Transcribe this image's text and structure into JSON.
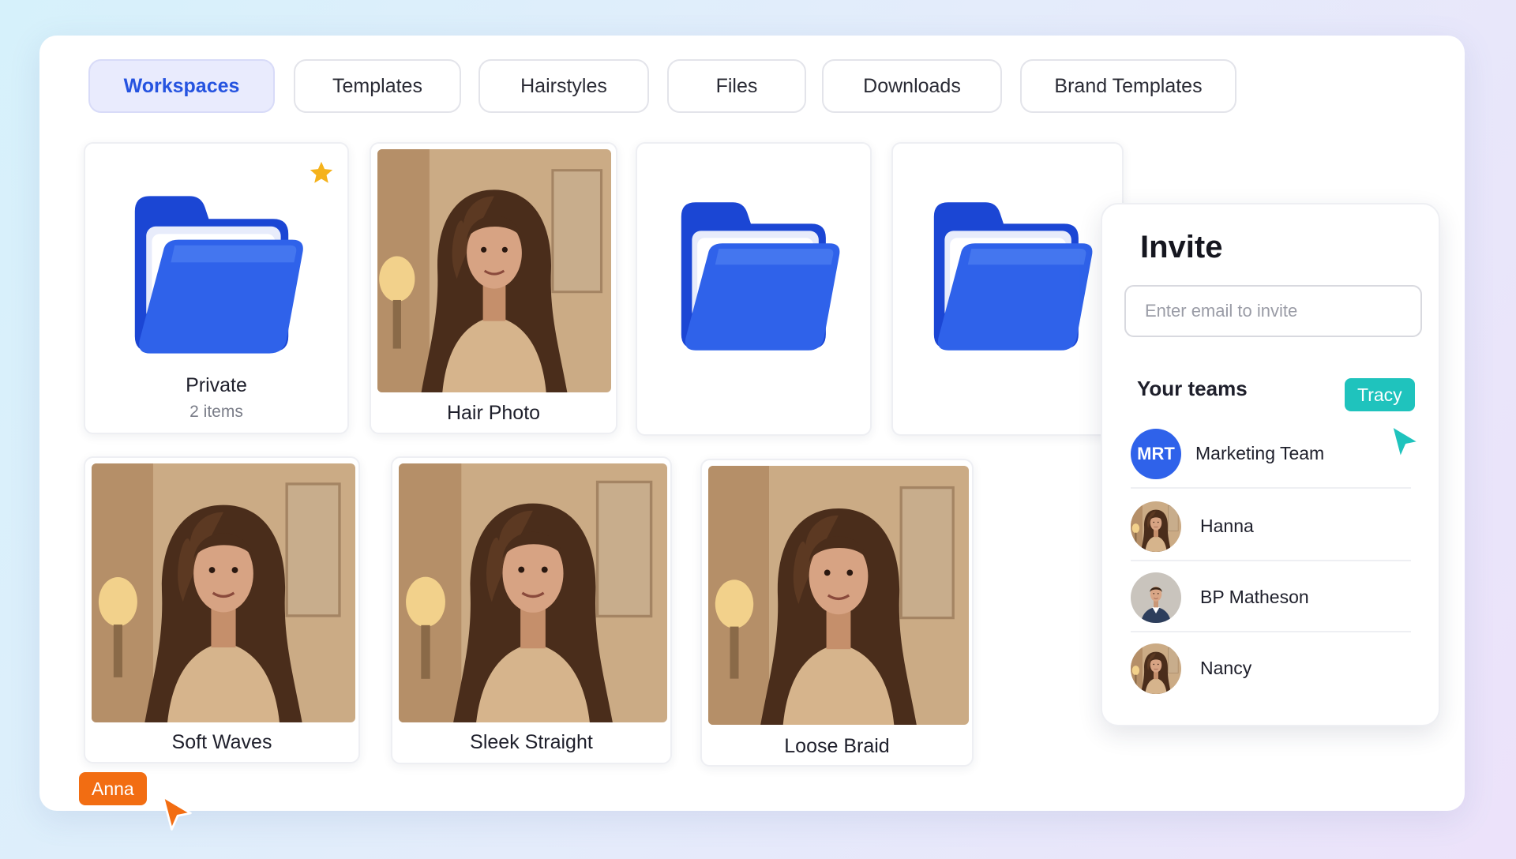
{
  "tabs": [
    {
      "label": "Workspaces",
      "active": true
    },
    {
      "label": "Templates",
      "active": false
    },
    {
      "label": "Hairstyles",
      "active": false
    },
    {
      "label": "Files",
      "active": false
    },
    {
      "label": "Downloads",
      "active": false
    },
    {
      "label": "Brand Templates",
      "active": false
    }
  ],
  "grid": {
    "private_folder": {
      "title": "Private",
      "subtitle": "2 items",
      "icon": "folder-icon",
      "badge_icon": "star-icon"
    },
    "hair_photo": {
      "title": "Hair Photo"
    },
    "folder_3": {
      "icon": "folder-icon"
    },
    "folder_4": {
      "icon": "folder-icon"
    },
    "soft_waves": {
      "title": "Soft Waves"
    },
    "sleek_straight": {
      "title": "Sleek Straight"
    },
    "loose_braid": {
      "title": "Loose Braid"
    }
  },
  "invite": {
    "title": "Invite",
    "email_placeholder": "Enter email to invite",
    "email_value": "",
    "teams_title": "Your teams",
    "members": [
      {
        "name": "Marketing Team",
        "initials": "MRT"
      },
      {
        "name": "Hanna"
      },
      {
        "name": "BP Matheson"
      },
      {
        "name": "Nancy"
      }
    ]
  },
  "cursors": [
    {
      "name": "Tracy",
      "color": "#1fc3bd"
    },
    {
      "name": "Anna",
      "color": "#f26d12"
    }
  ],
  "colors": {
    "accent": "#2553e0",
    "folder_blue": "#2f62ea",
    "star": "#f5b21b"
  }
}
